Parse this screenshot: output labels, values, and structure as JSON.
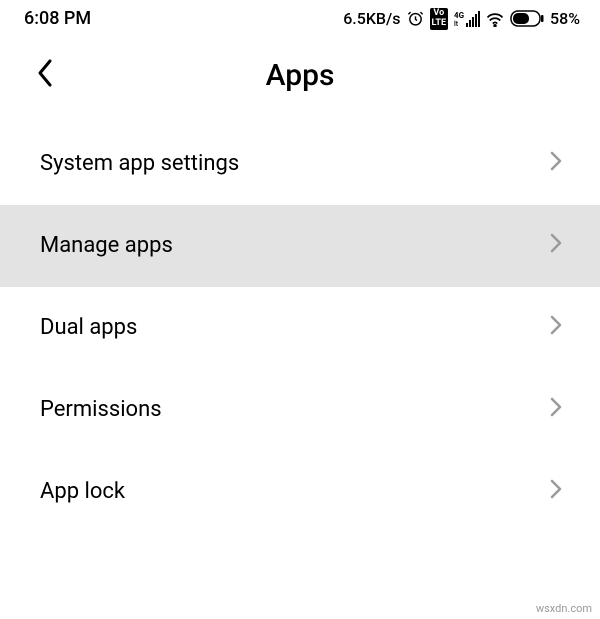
{
  "status": {
    "time": "6:08 PM",
    "data_rate": "6.5KB/s",
    "volte": "Vo\nLTE",
    "network": "4G",
    "battery_pct": "58%"
  },
  "header": {
    "title": "Apps"
  },
  "list": {
    "items": [
      {
        "label": "System app settings",
        "highlighted": false
      },
      {
        "label": "Manage apps",
        "highlighted": true
      },
      {
        "label": "Dual apps",
        "highlighted": false
      },
      {
        "label": "Permissions",
        "highlighted": false
      },
      {
        "label": "App lock",
        "highlighted": false
      }
    ]
  },
  "watermark": "wsxdn.com"
}
